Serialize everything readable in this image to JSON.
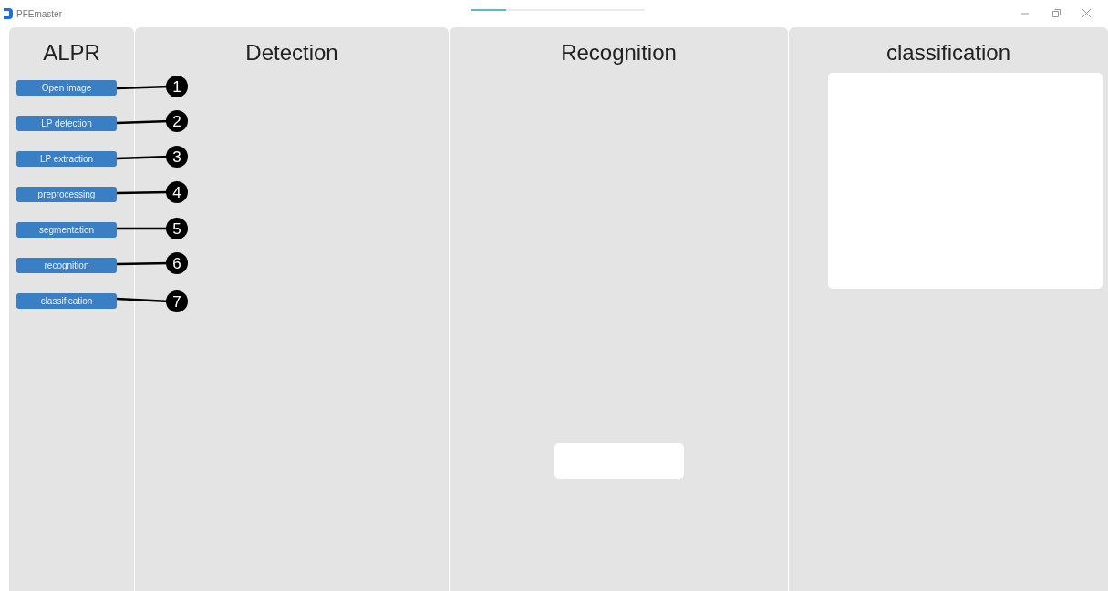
{
  "window": {
    "title": "PFEmaster"
  },
  "progress": {
    "level": 0.2
  },
  "sidebar": {
    "heading": "ALPR",
    "buttons": [
      {
        "label": "Open image",
        "callout": "1"
      },
      {
        "label": "LP detection",
        "callout": "2"
      },
      {
        "label": "LP extraction",
        "callout": "3"
      },
      {
        "label": "preprocessing",
        "callout": "4"
      },
      {
        "label": "segmentation",
        "callout": "5"
      },
      {
        "label": "recognition",
        "callout": "6"
      },
      {
        "label": "classification",
        "callout": "7"
      }
    ]
  },
  "panels": [
    {
      "heading": "Detection"
    },
    {
      "heading": "Recognition"
    },
    {
      "heading": "classification"
    }
  ]
}
